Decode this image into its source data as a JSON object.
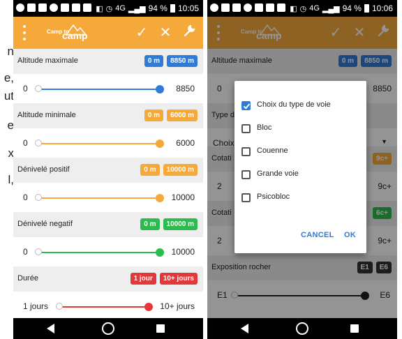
{
  "colors": {
    "accent": "#f5a93b",
    "blue": "#2f7bd6",
    "orange": "#f5a93b",
    "green": "#2dbb4f",
    "red": "#e2383a",
    "dark": "#333333"
  },
  "background_text": [
    "n",
    "e,",
    "ut",
    "e",
    "x",
    "l,"
  ],
  "status_bar": {
    "left_icons": [
      "circle-icon",
      "youtube-icon",
      "gmail-icon",
      "circle-icon",
      "image-icon",
      "sim-icon",
      "sim-icon"
    ],
    "left": {
      "battery_percent": "94 %",
      "time": "10:05"
    },
    "right": {
      "battery_percent": "94 %",
      "time": "10:06"
    },
    "network": "4G"
  },
  "app_bar": {
    "logo_small": "Camp to",
    "logo_big": "camp",
    "actions": [
      "check-icon",
      "close-icon",
      "wrench-icon"
    ]
  },
  "left_screen": {
    "sections": [
      {
        "title": "Altitude maximale",
        "badges": [
          {
            "text": "0 m",
            "color": "#2f7bd6"
          },
          {
            "text": "8850 m",
            "color": "#2f7bd6"
          }
        ],
        "slider": {
          "min_label": "0",
          "max_label": "8850",
          "color": "#2f7bd6",
          "range_fraction": [
            0.0,
            1.0
          ]
        }
      },
      {
        "title": "Altitude minimale",
        "badges": [
          {
            "text": "0 m",
            "color": "#f5a93b"
          },
          {
            "text": "6000 m",
            "color": "#f5a93b"
          }
        ],
        "slider": {
          "min_label": "0",
          "max_label": "6000",
          "color": "#f5a93b",
          "range_fraction": [
            0.0,
            1.0
          ]
        }
      },
      {
        "title": "Dénivelé positif",
        "badges": [
          {
            "text": "0 m",
            "color": "#f5a93b"
          },
          {
            "text": "10000 m",
            "color": "#f5a93b"
          }
        ],
        "slider": {
          "min_label": "0",
          "max_label": "10000",
          "color": "#f5a93b",
          "range_fraction": [
            0.0,
            1.0
          ]
        }
      },
      {
        "title": "Dénivelé negatif",
        "badges": [
          {
            "text": "0 m",
            "color": "#2dbb4f"
          },
          {
            "text": "10000 m",
            "color": "#2dbb4f"
          }
        ],
        "slider": {
          "min_label": "0",
          "max_label": "10000",
          "color": "#2dbb4f",
          "range_fraction": [
            0.0,
            1.0
          ]
        }
      },
      {
        "title": "Durée",
        "badges": [
          {
            "text": "1 jour",
            "color": "#e2383a"
          },
          {
            "text": "10+ jours",
            "color": "#e2383a"
          }
        ],
        "slider": {
          "min_label": "1 jours",
          "max_label": "10+ jours",
          "color": "#e2383a",
          "range_fraction": [
            0.0,
            1.0
          ]
        }
      }
    ]
  },
  "right_screen": {
    "background": {
      "altitude": {
        "title": "Altitude maximale",
        "badges": [
          "0 m",
          "8850 m"
        ],
        "min_label": "0",
        "max_label": "8850"
      },
      "type_header": "Type d",
      "type_select": "Choix",
      "cotation1": {
        "title": "Cotati",
        "badge": "9c+",
        "min_label": "2",
        "max_label": "9c+"
      },
      "cotation2": {
        "title": "Cotati",
        "badge": "6c+",
        "min_label": "2",
        "max_label": "9c+"
      },
      "exposition": {
        "title": "Exposition rocher",
        "badges": [
          "E1",
          "E6"
        ],
        "min_label": "E1",
        "max_label": "E6"
      }
    },
    "dialog": {
      "options": [
        {
          "label": "Choix du type de voie",
          "checked": true
        },
        {
          "label": "Bloc",
          "checked": false
        },
        {
          "label": "Couenne",
          "checked": false
        },
        {
          "label": "Grande voie",
          "checked": false
        },
        {
          "label": "Psicobloc",
          "checked": false
        }
      ],
      "cancel_label": "CANCEL",
      "ok_label": "OK"
    }
  }
}
